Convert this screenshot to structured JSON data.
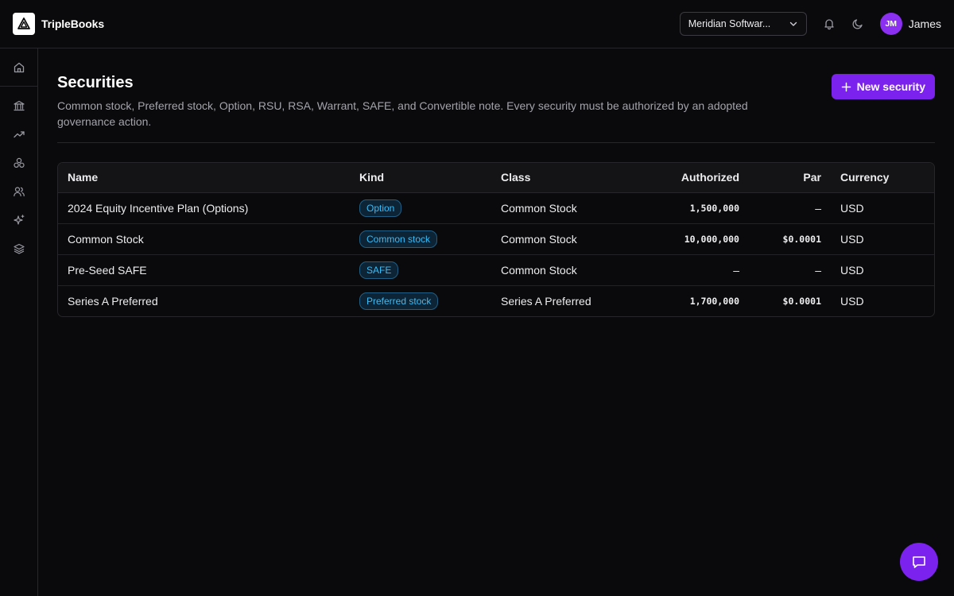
{
  "app": {
    "name": "TripleBooks"
  },
  "header": {
    "org_select": "Meridian Softwar...",
    "user": {
      "initials": "JM",
      "name": "James"
    }
  },
  "sidebar": {
    "items": [
      {
        "icon": "home-icon"
      },
      {
        "icon": "bank-icon"
      },
      {
        "icon": "trending-up-icon"
      },
      {
        "icon": "cap-table-icon"
      },
      {
        "icon": "users-icon"
      },
      {
        "icon": "sparkles-icon"
      },
      {
        "icon": "layers-icon"
      }
    ]
  },
  "page": {
    "title": "Securities",
    "description": "Common stock, Preferred stock, Option, RSU, RSA, Warrant, SAFE, and Convertible note. Every security must be authorized by an adopted governance action.",
    "new_button": "New security"
  },
  "table": {
    "columns": {
      "name": "Name",
      "kind": "Kind",
      "class": "Class",
      "authorized": "Authorized",
      "par": "Par",
      "currency": "Currency"
    },
    "rows": [
      {
        "name": "2024 Equity Incentive Plan (Options)",
        "kind": "Option",
        "class": "Common Stock",
        "authorized": "1,500,000",
        "par": "–",
        "currency": "USD"
      },
      {
        "name": "Common Stock",
        "kind": "Common stock",
        "class": "Common Stock",
        "authorized": "10,000,000",
        "par": "$0.0001",
        "currency": "USD"
      },
      {
        "name": "Pre-Seed SAFE",
        "kind": "SAFE",
        "class": "Common Stock",
        "authorized": "–",
        "par": "–",
        "currency": "USD"
      },
      {
        "name": "Series A Preferred",
        "kind": "Preferred stock",
        "class": "Series A Preferred",
        "authorized": "1,700,000",
        "par": "$0.0001",
        "currency": "USD"
      }
    ]
  },
  "colors": {
    "accent": "#7c22ee",
    "avatar": "#8b2ff0",
    "badge_text": "#38bdf8",
    "background": "#0a0a0c"
  }
}
